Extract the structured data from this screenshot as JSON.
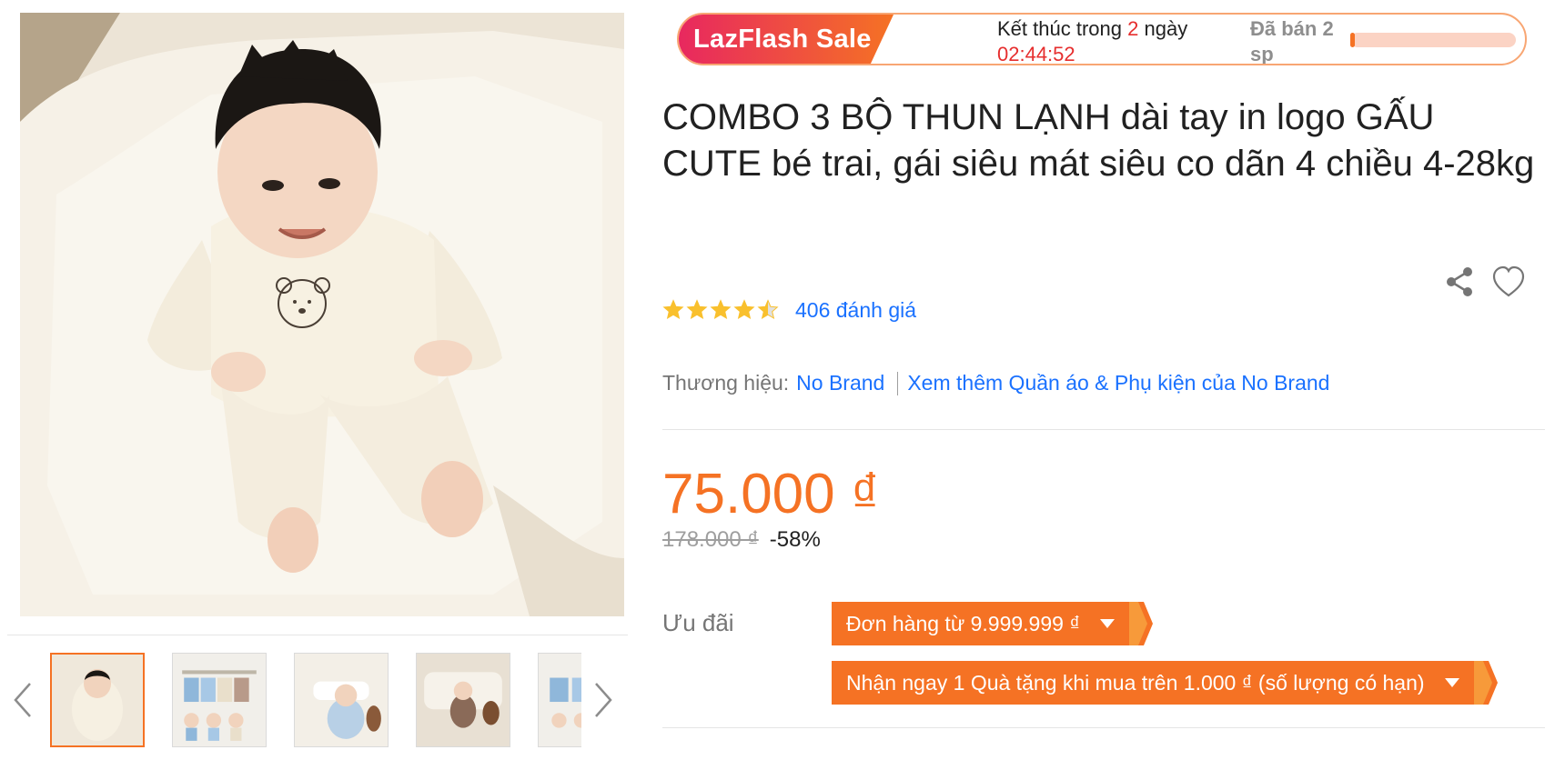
{
  "flash_sale": {
    "logo_text": "LazFlash Sale",
    "ends_prefix": "Kết thúc trong",
    "ends_days": "2",
    "ends_days_suffix": "ngày",
    "ends_time": "02:44:52",
    "sold_text": "Đã bán 2 sp",
    "sold_progress": 0.03,
    "logo_gradient": [
      "#e8285f",
      "#f57224"
    ],
    "bar_track_color": "#fbd3c4"
  },
  "product": {
    "title": "COMBO 3 BỘ THUN LẠNH dài tay in logo GẤU CUTE bé trai, gái siêu mát siêu co dãn 4 chiều 4-28kg",
    "rating_value": 4.5,
    "rating_link": "406 đánh giá",
    "brand_label": "Thương hiệu:",
    "brand_name": "No Brand",
    "brand_more": "Xem thêm Quần áo & Phụ kiện của No Brand",
    "price": "75.000 ₫",
    "old_price": "178.000 ₫",
    "discount": "-58%"
  },
  "promotions": {
    "label": "Ưu đãi",
    "vouchers": [
      "Đơn hàng từ 9.999.999 ₫",
      "Nhận ngay 1 Quà tặng khi mua trên 1.000 ₫ (số lượng có hạn)"
    ]
  },
  "gallery": {
    "active_index": 0,
    "thumbnails": [
      "baby-cream-set",
      "product-colors-grid",
      "baby-blue-set",
      "baby-brown-set",
      "product-colors-grid-2"
    ]
  },
  "icons": {
    "share": "share-icon",
    "favorite": "heart-icon",
    "prev": "chevron-left-icon",
    "next": "chevron-right-icon",
    "caret": "caret-down-icon",
    "star": "star-icon"
  },
  "colors": {
    "accent": "#f57224",
    "link": "#1a71ff",
    "star": "#f9c02d",
    "countdown": "#e62e2e"
  }
}
